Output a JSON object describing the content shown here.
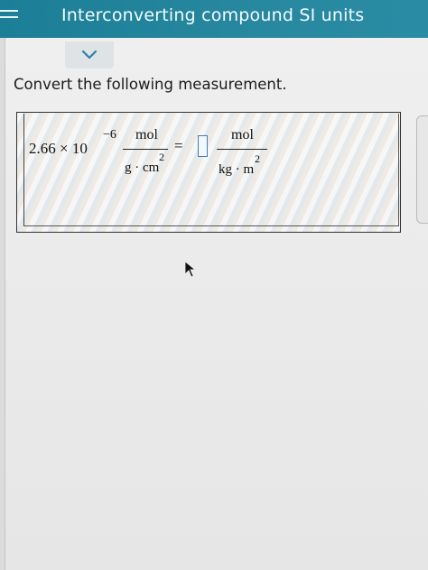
{
  "header": {
    "title": "Interconverting compound SI units",
    "menu_icon": "hamburger-menu-icon",
    "bg_color": "#27889f"
  },
  "collapse": {
    "icon": "chevron-down-icon"
  },
  "problem": {
    "instruction": "Convert the following measurement."
  },
  "expression": {
    "coefficient": "2.66 × 10",
    "exponent": "−6",
    "given_numerator": "mol",
    "given_denominator": "g · cm",
    "given_denominator_power": "2",
    "equals": "=",
    "answer_value": "",
    "target_numerator": "mol",
    "target_denominator": "kg · m",
    "target_denominator_power": "2"
  }
}
